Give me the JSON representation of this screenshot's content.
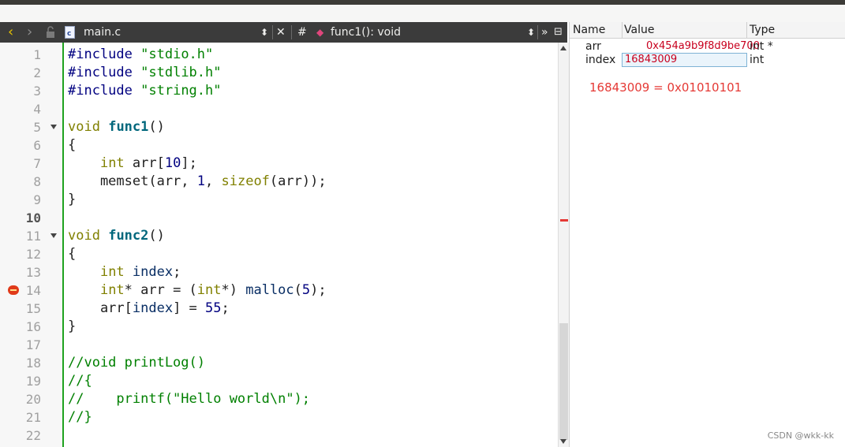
{
  "editor_toolbar": {
    "back_icon": "chevron-left",
    "forward_icon": "chevron-right",
    "file_name": "main.c",
    "symbol_hash": "#",
    "function_label": "func1(): void",
    "more": "»"
  },
  "editor": {
    "line_numbers": [
      "1",
      "2",
      "3",
      "4",
      "5",
      "6",
      "7",
      "8",
      "9",
      "10",
      "11",
      "12",
      "13",
      "14",
      "15",
      "16",
      "17",
      "18",
      "19",
      "20",
      "21",
      "22"
    ],
    "current_line": "10",
    "breakpoint_line": "14",
    "lines": [
      "#include \"stdio.h\"",
      "#include \"stdlib.h\"",
      "#include \"string.h\"",
      "",
      "void func1()",
      "{",
      "    int arr[10];",
      "    memset(arr, 1, sizeof(arr));",
      "}",
      "",
      "void func2()",
      "{",
      "    int index;",
      "    int* arr = (int*) malloc(5);",
      "    arr[index] = 55;",
      "}",
      "",
      "//void printLog()",
      "//{",
      "//    printf(\"Hello world\\n\");",
      "//}",
      ""
    ]
  },
  "locals": {
    "headers": {
      "name": "Name",
      "value": "Value",
      "type": "Type"
    },
    "rows": [
      {
        "name": "arr",
        "value": "0x454a9b9f8d9be700",
        "type": "int *"
      },
      {
        "name": "index",
        "value": "16843009",
        "type": "int"
      }
    ],
    "annotation": "16843009 = 0x01010101"
  },
  "watermark": "CSDN @wkk-kk"
}
